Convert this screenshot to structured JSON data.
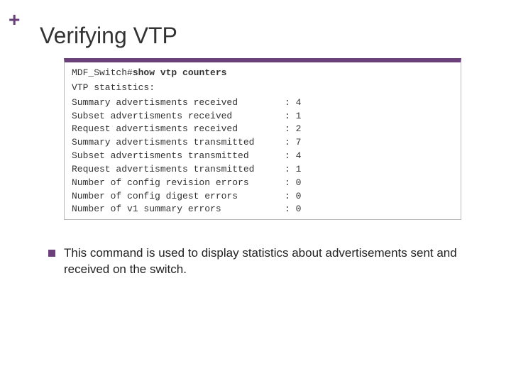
{
  "colors": {
    "accent": "#6a3f7a"
  },
  "plus": "+",
  "title": "Verifying VTP",
  "terminal": {
    "prompt": "MDF_Switch#",
    "command": "show vtp counters",
    "stats_header": "VTP statistics:",
    "rows": [
      {
        "label": "Summary advertisments received",
        "value": ": 4"
      },
      {
        "label": "Subset advertisments received",
        "value": ": 1"
      },
      {
        "label": "Request advertisments received",
        "value": ": 2"
      },
      {
        "label": "Summary advertisments transmitted",
        "value": ": 7"
      },
      {
        "label": "Subset advertisments transmitted",
        "value": ": 4"
      },
      {
        "label": "Request advertisments transmitted",
        "value": ": 1"
      },
      {
        "label": "Number of config revision errors",
        "value": ": 0"
      },
      {
        "label": "Number of config digest errors",
        "value": ": 0"
      },
      {
        "label": "Number of v1 summary errors",
        "value": ": 0"
      }
    ]
  },
  "bullet": "This command is used to display statistics about advertisements sent and received on the switch."
}
